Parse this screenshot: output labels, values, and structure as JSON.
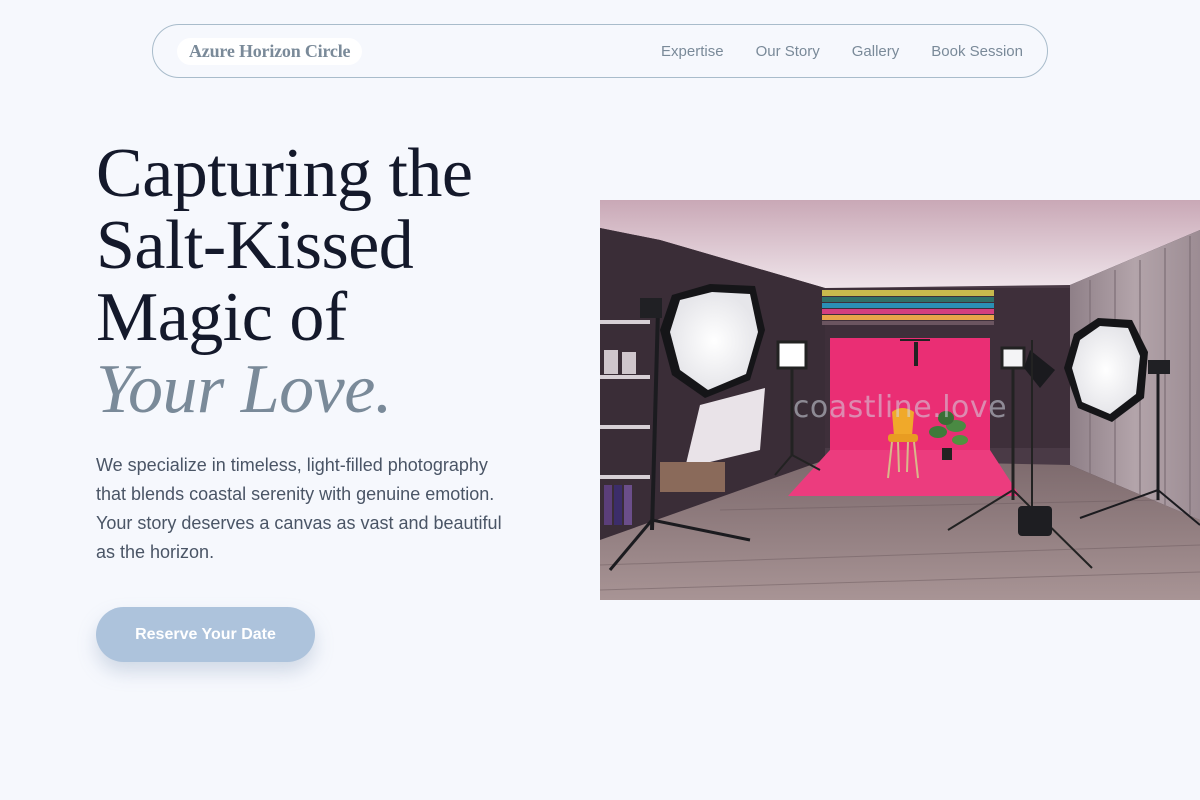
{
  "brand": {
    "name": "Azure Horizon Circle"
  },
  "nav": {
    "links": [
      {
        "label": "Expertise"
      },
      {
        "label": "Our Story"
      },
      {
        "label": "Gallery"
      },
      {
        "label": "Book Session"
      }
    ]
  },
  "hero": {
    "title_lines": [
      "Capturing the",
      "Salt-Kissed",
      "Magic of"
    ],
    "title_accent": "Your Love.",
    "description": "We specialize in timeless, light-filled photography that blends coastal serenity with genuine emotion. Your story deserves a canvas as vast and beautiful as the horizon.",
    "cta_label": "Reserve Your Date"
  },
  "photo": {
    "watermark": "coastline.love"
  },
  "colors": {
    "background": "#f6f8fd",
    "muted_text": "#7a8a99",
    "heading": "#14192b",
    "body_text": "#4a5566",
    "cta_background": "#adc3dc",
    "backdrop_pink": "#ea2e74"
  }
}
